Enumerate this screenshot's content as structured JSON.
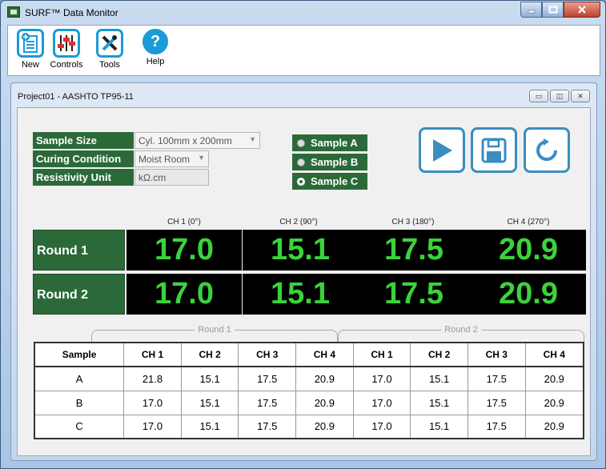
{
  "window": {
    "title": "SURF™ Data Monitor"
  },
  "toolbar": {
    "items": [
      {
        "label": "New",
        "icon": "new-document-icon"
      },
      {
        "label": "Controls",
        "icon": "sliders-icon"
      },
      {
        "label": "Tools",
        "icon": "tools-icon"
      },
      {
        "label": "Help",
        "icon": "help-icon"
      }
    ]
  },
  "project": {
    "title": "Project01 - AASHTO TP95-11",
    "settings": [
      {
        "label": "Sample Size",
        "value": "Cyl. 100mm x 200mm",
        "dropdown": true
      },
      {
        "label": "Curing Condition",
        "value": "Moist Room",
        "dropdown": true
      },
      {
        "label": "Resistivity Unit",
        "value": "kΩ.cm",
        "dropdown": false
      }
    ],
    "samples": [
      {
        "label": "Sample A",
        "selected": false
      },
      {
        "label": "Sample B",
        "selected": false
      },
      {
        "label": "Sample C",
        "selected": true
      }
    ],
    "actions": [
      "play",
      "save",
      "refresh"
    ],
    "channels": [
      "CH 1 (0°)",
      "CH 2 (90°)",
      "CH 3 (180°)",
      "CH 4 (270°)"
    ],
    "rounds": [
      {
        "label": "Round 1",
        "values": [
          "17.0",
          "15.1",
          "17.5",
          "20.9"
        ]
      },
      {
        "label": "Round 2",
        "values": [
          "17.0",
          "15.1",
          "17.5",
          "20.9"
        ]
      }
    ],
    "brackets": [
      "Round 1",
      "Round 2"
    ],
    "table": {
      "headers": [
        "Sample",
        "CH 1",
        "CH 2",
        "CH 3",
        "CH 4",
        "CH 1",
        "CH 2",
        "CH 3",
        "CH 4"
      ],
      "rows": [
        [
          "A",
          "21.8",
          "15.1",
          "17.5",
          "20.9",
          "17.0",
          "15.1",
          "17.5",
          "20.9"
        ],
        [
          "B",
          "17.0",
          "15.1",
          "17.5",
          "20.9",
          "17.0",
          "15.1",
          "17.5",
          "20.9"
        ],
        [
          "C",
          "17.0",
          "15.1",
          "17.5",
          "20.9",
          "17.0",
          "15.1",
          "17.5",
          "20.9"
        ]
      ]
    }
  },
  "colors": {
    "label_bg": "#2b6a38",
    "digit": "#3bd23b",
    "accent": "#1a9ad6"
  }
}
